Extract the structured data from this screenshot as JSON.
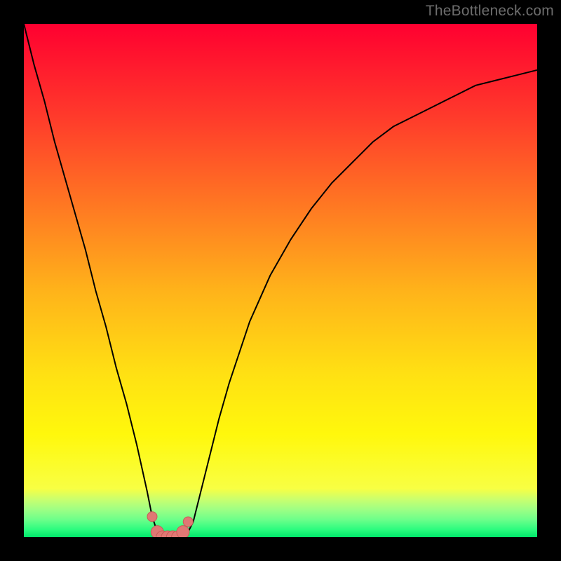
{
  "watermark": "TheBottleneck.com",
  "chart_data": {
    "type": "line",
    "title": "",
    "xlabel": "",
    "ylabel": "",
    "xlim": [
      0,
      100
    ],
    "ylim": [
      0,
      100
    ],
    "x": [
      0,
      2,
      4,
      6,
      8,
      10,
      12,
      14,
      16,
      18,
      20,
      22,
      24,
      25,
      26,
      27,
      28,
      29,
      30,
      31,
      32,
      33,
      34,
      36,
      38,
      40,
      44,
      48,
      52,
      56,
      60,
      64,
      68,
      72,
      76,
      80,
      84,
      88,
      92,
      96,
      100
    ],
    "values": [
      100,
      92,
      85,
      77,
      70,
      63,
      56,
      48,
      41,
      33,
      26,
      18,
      9,
      4,
      1,
      0,
      0,
      0,
      0,
      0,
      1,
      3,
      7,
      15,
      23,
      30,
      42,
      51,
      58,
      64,
      69,
      73,
      77,
      80,
      82,
      84,
      86,
      88,
      89,
      90,
      91
    ],
    "marker_points_x": [
      25,
      26,
      27,
      28,
      29,
      30,
      31,
      32
    ],
    "marker_points_y": [
      4,
      1,
      0,
      0,
      0,
      0,
      1,
      3
    ],
    "gradient_stops": [
      {
        "offset": 0.0,
        "color": "#ff0030"
      },
      {
        "offset": 0.18,
        "color": "#ff3a2b"
      },
      {
        "offset": 0.36,
        "color": "#ff7a22"
      },
      {
        "offset": 0.52,
        "color": "#ffb31a"
      },
      {
        "offset": 0.68,
        "color": "#ffe013"
      },
      {
        "offset": 0.8,
        "color": "#fff80c"
      },
      {
        "offset": 0.905,
        "color": "#f8ff43"
      },
      {
        "offset": 0.926,
        "color": "#caff6e"
      },
      {
        "offset": 0.946,
        "color": "#9eff84"
      },
      {
        "offset": 0.966,
        "color": "#6cff8a"
      },
      {
        "offset": 0.985,
        "color": "#2cfc7f"
      },
      {
        "offset": 1.0,
        "color": "#00e66a"
      }
    ],
    "curve_color": "#000000",
    "marker_fill": "#e07874",
    "marker_stroke": "#c85c58"
  }
}
